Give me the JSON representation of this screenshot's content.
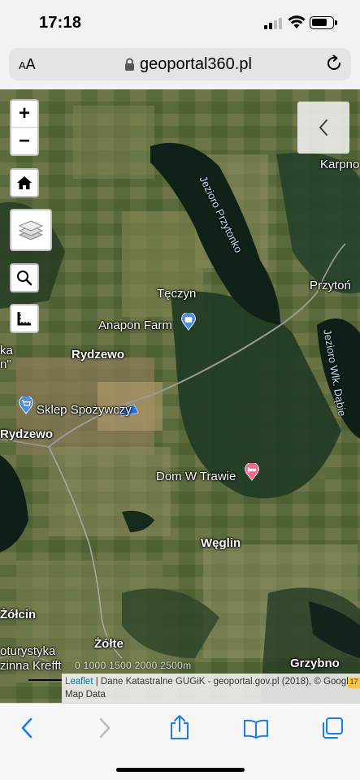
{
  "status": {
    "time": "17:18",
    "battery_level_pct": 80
  },
  "browser": {
    "text_size_label_big": "A",
    "text_size_label_small": "A",
    "domain": "geoportal360.pl",
    "icons": [
      "lock-icon",
      "reload-icon"
    ]
  },
  "map_controls": {
    "zoom_in": "+",
    "zoom_out": "−",
    "icons": [
      "home-icon",
      "layers-icon",
      "search-icon",
      "measure-icon",
      "chevron-left-icon"
    ]
  },
  "places": {
    "karpno": "Karpno",
    "teczyn": "Tęczyn",
    "anapon": "Anapon Farm",
    "przyton": "Przytoń",
    "rydzewo1": "Rydzewo",
    "sklep": "Sklep Spożywczy",
    "rydzewo2": "Rydzewo",
    "dom": "Dom W Trawie",
    "weglin": "Węglin",
    "zolcin": "Żółcin",
    "zolte": "Żółte",
    "grzybno": "Grzybno",
    "turystyka1": "oturystyka",
    "turystyka2": "zinna Krefft",
    "cut_ka": "ka",
    "cut_n": "n\""
  },
  "lakes": {
    "przytonko": "Jezioro Przytonko",
    "wlk_dabie": "Jezioro Wlk. Dąbie"
  },
  "scale": {
    "text": "0    1000    1500    2000    2500m"
  },
  "attribution": {
    "leaflet": "Leaflet",
    "text": " | Dane Katastralne GUGiK - geoportal.gov.pl (2018), © Google Map Data",
    "badge": "17"
  },
  "toolbar": {
    "icons": [
      "back-icon",
      "forward-icon",
      "share-icon",
      "bookmarks-icon",
      "tabs-icon"
    ]
  },
  "colors": {
    "accent": "#1a7cf0",
    "marker_blue": "#4f8de0",
    "marker_pink": "#ea6b8d"
  }
}
